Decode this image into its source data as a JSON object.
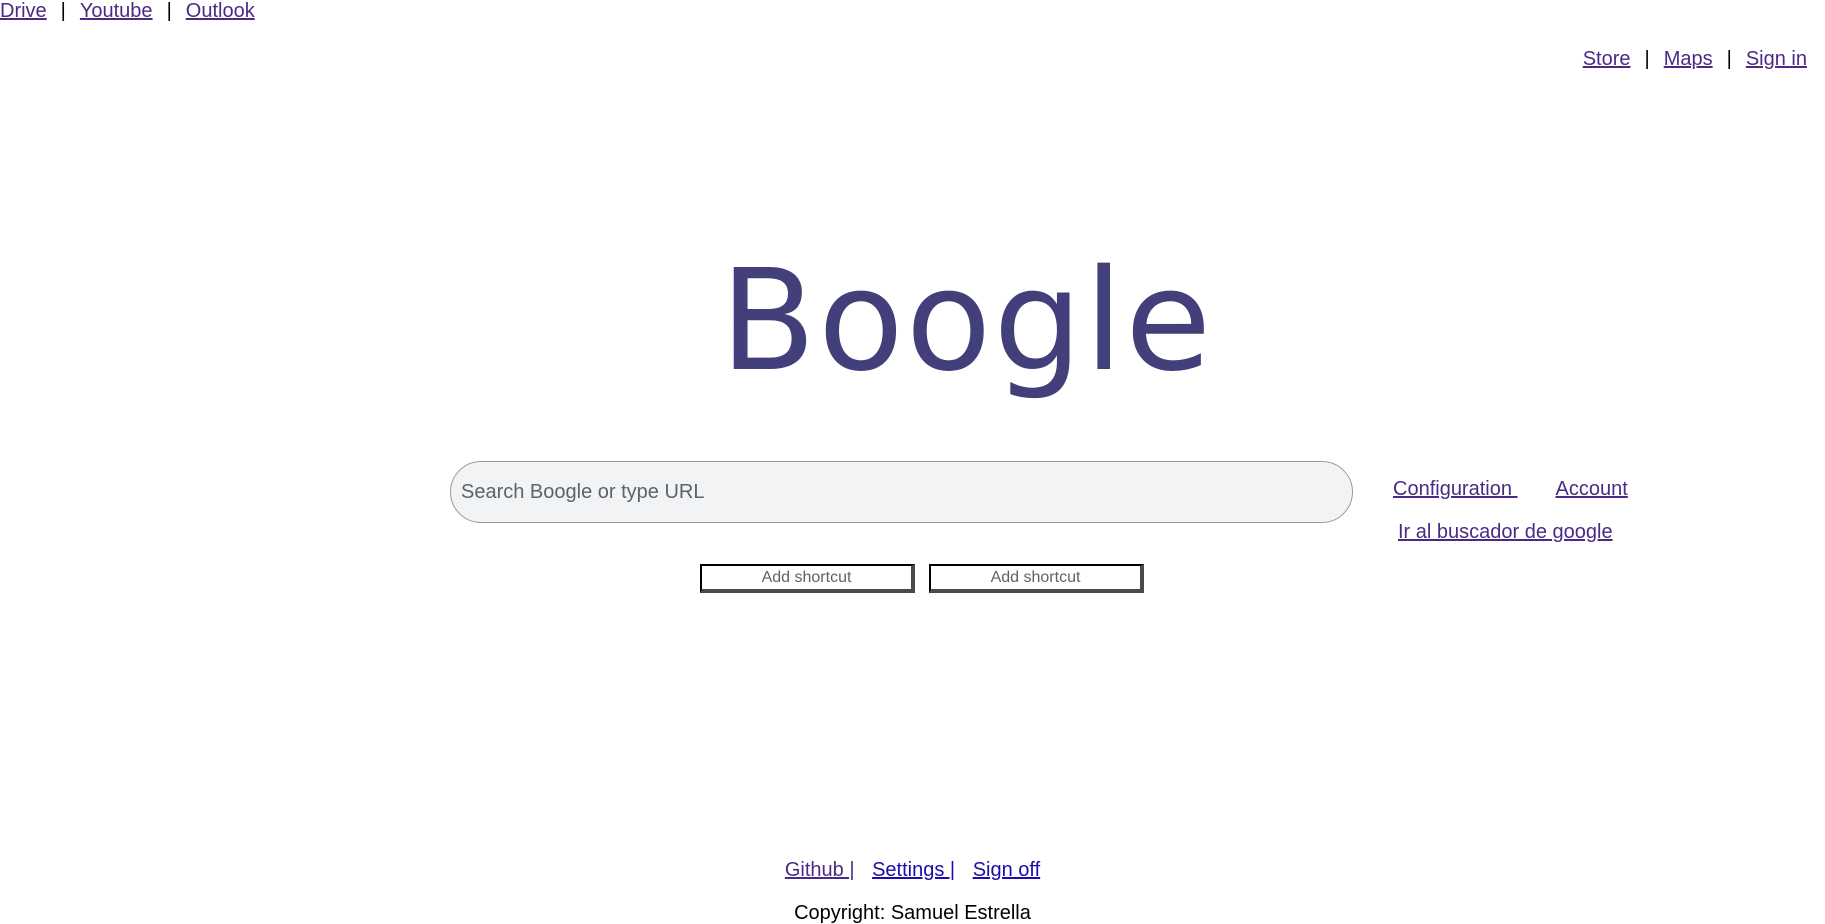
{
  "top_left_nav": {
    "items": [
      "Drive",
      "Youtube",
      "Outlook"
    ],
    "separator": "|"
  },
  "top_right_nav": {
    "items": [
      "Store",
      "Maps",
      "Sign in"
    ],
    "separator": "|"
  },
  "logo": {
    "text": "Boogle",
    "color": "#433f7a"
  },
  "search": {
    "placeholder": "Search Boogle or type URL",
    "value": ""
  },
  "side_links": {
    "configuration": "Configuration ",
    "account": "Account",
    "google_search": "Ir al buscador de google"
  },
  "shortcuts": [
    "Add shortcut",
    "Add shortcut"
  ],
  "footer": {
    "links": [
      "Github |",
      "Settings |",
      "Sign off"
    ],
    "copyright": "Copyright: Samuel Estrella"
  },
  "colors": {
    "link_visited": "#4b2a86",
    "link": "#1a0dab",
    "search_bg": "#f1f3f4"
  }
}
